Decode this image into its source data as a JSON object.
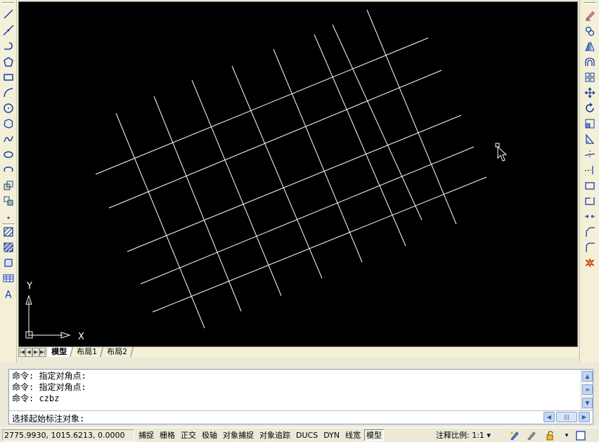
{
  "tabs": {
    "items": [
      {
        "label": "模型"
      },
      {
        "label": "布局1"
      },
      {
        "label": "布局2"
      }
    ]
  },
  "ucs": {
    "x_label": "X",
    "y_label": "Y"
  },
  "command": {
    "history": [
      "命令: 指定对角点:",
      "命令: 指定对角点:",
      "命令: czbz"
    ],
    "prompt": "选择起始标注对象:"
  },
  "status": {
    "coordinates": "2775.9930, 1015.6213, 0.0000",
    "buttons": [
      "捕捉",
      "栅格",
      "正交",
      "极轴",
      "对象捕捉",
      "对象追踪",
      "DUCS",
      "DYN",
      "线宽",
      "模型"
    ],
    "scale_label": "注释比例:",
    "scale_value": "1:1"
  },
  "icons": {
    "draw_toolbar": [
      "line-icon",
      "construction-line-icon",
      "polyline-icon",
      "polygon-icon",
      "rectangle-icon",
      "arc-icon",
      "circle-icon",
      "revision-cloud-icon",
      "spline-icon",
      "ellipse-icon",
      "ellipse-arc-icon",
      "insert-block-icon",
      "make-block-icon",
      "point-icon",
      "hatch-icon",
      "gradient-icon",
      "region-icon",
      "table-icon",
      "multiline-text-icon"
    ],
    "modify_toolbar": [
      "erase-icon",
      "copy-icon",
      "mirror-icon",
      "offset-icon",
      "array-icon",
      "move-icon",
      "rotate-icon",
      "scale-icon",
      "stretch-icon",
      "trim-icon",
      "extend-icon",
      "break-at-point-icon",
      "break-icon",
      "join-icon",
      "chamfer-icon",
      "fillet-icon",
      "explode-icon"
    ]
  },
  "colors": {
    "canvas": "#000000",
    "grid_lines": "#ffffff",
    "toolbar_bg": "#f4f0d8"
  }
}
